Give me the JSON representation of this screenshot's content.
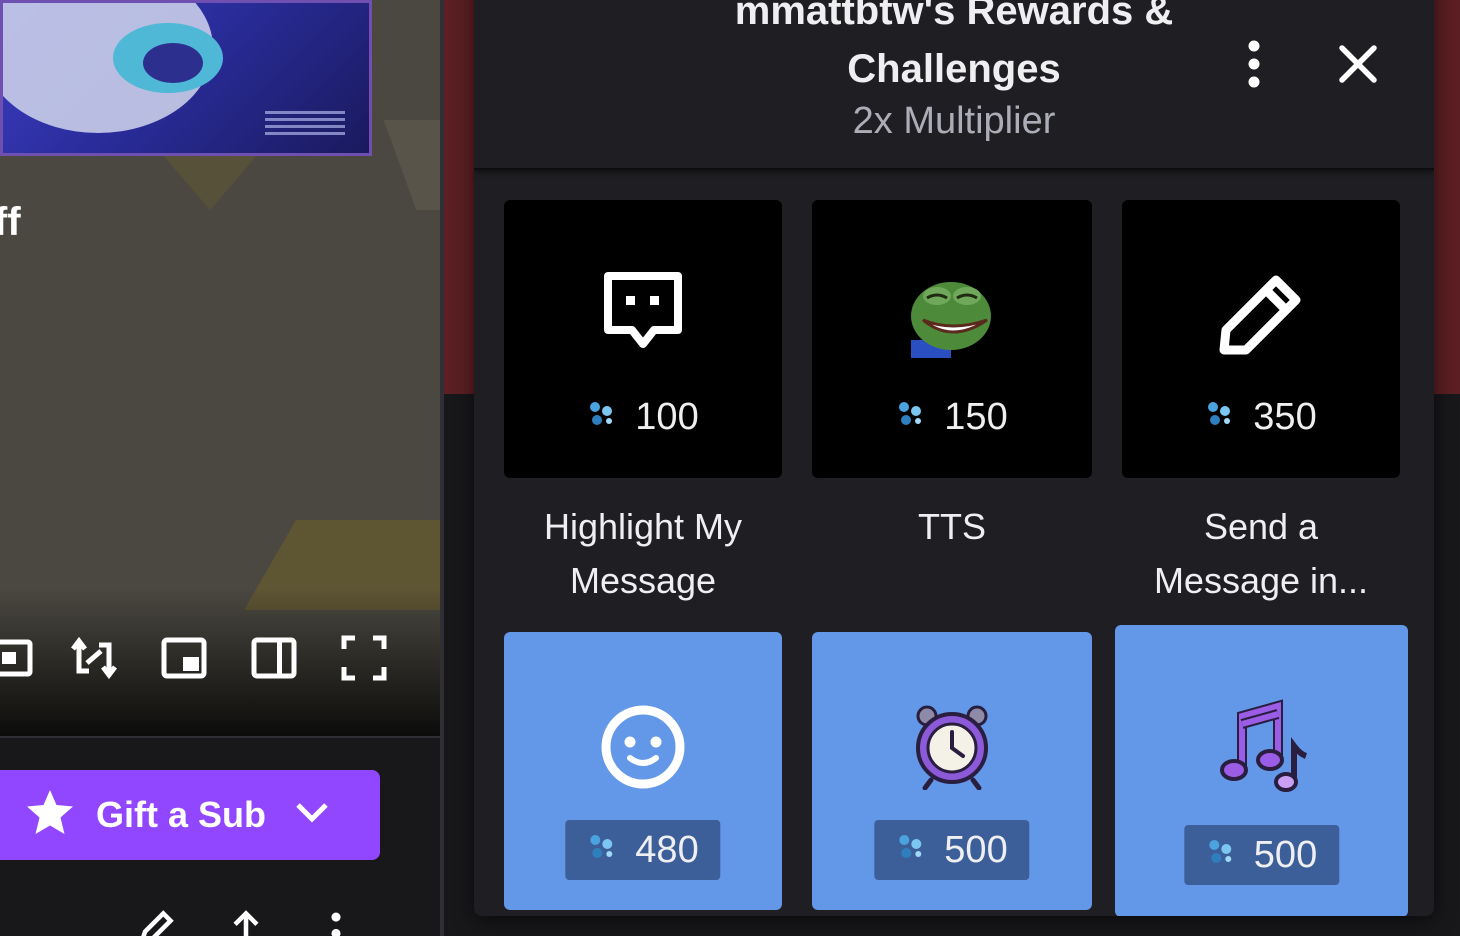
{
  "player": {
    "side_text": "ff",
    "controls": [
      "theatre-mode",
      "swap",
      "picture-in-picture",
      "sidebar-toggle",
      "fullscreen"
    ]
  },
  "gift": {
    "label": "Gift a Sub"
  },
  "panel": {
    "title_line1": "mmattbtw's Rewards &",
    "title_line2": "Challenges",
    "subtitle": "2x Multiplier"
  },
  "rewards": [
    {
      "name": "Highlight My Message",
      "cost": "100",
      "icon": "chat-highlight-icon"
    },
    {
      "name": "TTS",
      "cost": "150",
      "icon": "pepe-laugh-emote"
    },
    {
      "name": "Send a Message in...",
      "cost": "350",
      "icon": "pencil-icon"
    },
    {
      "name": "",
      "cost": "480",
      "icon": "smiley-icon"
    },
    {
      "name": "",
      "cost": "500",
      "icon": "alarm-clock-icon"
    },
    {
      "name": "",
      "cost": "500",
      "icon": "music-notes-icon"
    }
  ],
  "colors": {
    "accent": "#9147ff",
    "panel_bg": "#1f1f23",
    "tile_blue": "#6397e8",
    "maroon": "#5c1f23"
  }
}
